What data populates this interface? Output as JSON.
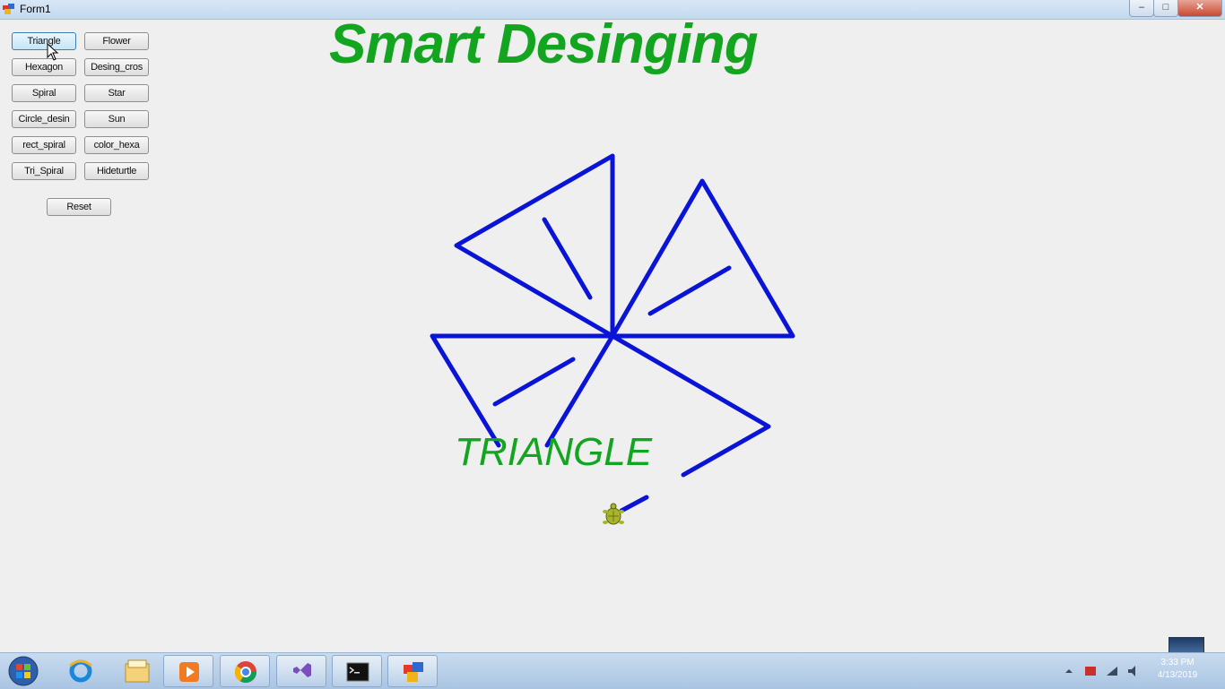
{
  "window": {
    "title": "Form1"
  },
  "heading": "Smart Desinging",
  "shape_label": "TRIANGLE",
  "buttons": [
    {
      "label": "Triangle",
      "active": true
    },
    {
      "label": "Flower"
    },
    {
      "label": "Hexagon"
    },
    {
      "label": "Desing_cros"
    },
    {
      "label": "Spiral"
    },
    {
      "label": "Star"
    },
    {
      "label": "Circle_desin"
    },
    {
      "label": "Sun"
    },
    {
      "label": "rect_spiral"
    },
    {
      "label": "color_hexa"
    },
    {
      "label": "Tri_Spiral"
    },
    {
      "label": "Hideturtle"
    }
  ],
  "reset_label": "Reset",
  "colors": {
    "heading": "#13a51f",
    "stroke": "#0a14d6",
    "label": "#13a51f"
  },
  "taskbar": {
    "items": [
      "start-orb",
      "internet-explorer-icon",
      "file-explorer-icon",
      "media-player-icon",
      "chrome-icon",
      "visual-studio-icon",
      "command-prompt-icon",
      "form-app-icon"
    ],
    "clock_time": "3:33 PM",
    "clock_date": "4/13/2019"
  }
}
